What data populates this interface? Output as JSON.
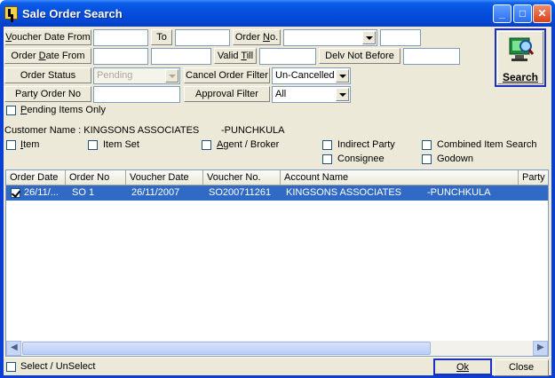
{
  "window": {
    "title": "Sale Order Search"
  },
  "filters": {
    "voucher_date_from_label": "Voucher Date From",
    "voucher_date_from_value": "",
    "to_label": "To",
    "to_value": "",
    "order_no_label": "Order No.",
    "order_no_value": "",
    "order_no_extra_value": "",
    "order_date_from_label": "Order Date From",
    "order_date_from_value": "",
    "order_date_from_extra_value": "",
    "valid_till_label": "Valid Till",
    "valid_till_value": "",
    "delv_not_before_label": "Delv Not Before",
    "delv_not_before_value": "",
    "order_status_label": "Order Status",
    "order_status_value": "Pending",
    "cancel_order_filter_label": "Cancel Order Filter",
    "cancel_order_filter_value": "Un-Cancelled",
    "party_order_no_label": "Party Order No",
    "party_order_no_value": "",
    "approval_filter_label": "Approval Filter",
    "approval_filter_value": "All",
    "pending_items_only_label": "Pending Items Only"
  },
  "customer": {
    "label": "Customer Name : KINGSONS ASSOCIATES",
    "city": "-PUNCHKULA"
  },
  "options": {
    "item": "Item",
    "item_set": "Item Set",
    "agent_broker": "Agent / Broker",
    "indirect_party": "Indirect Party",
    "combined_item_search": "Combined Item Search",
    "consignee": "Consignee",
    "godown": "Godown"
  },
  "search_button": {
    "label": "Search"
  },
  "grid": {
    "columns": [
      "Order Date",
      "Order No",
      "Voucher Date",
      "Voucher No.",
      "Account Name",
      "Party O"
    ],
    "rows": [
      {
        "order_date": "26/11/...",
        "order_no": "SO  1",
        "voucher_date": "26/11/2007",
        "voucher_no": "SO200711261",
        "account_name": "KINGSONS ASSOCIATES",
        "city": "-PUNCHKULA",
        "checked": true
      }
    ]
  },
  "footer": {
    "select_unselect_label": "Select / UnSelect",
    "ok_label": "Ok",
    "close_label": "Close"
  }
}
